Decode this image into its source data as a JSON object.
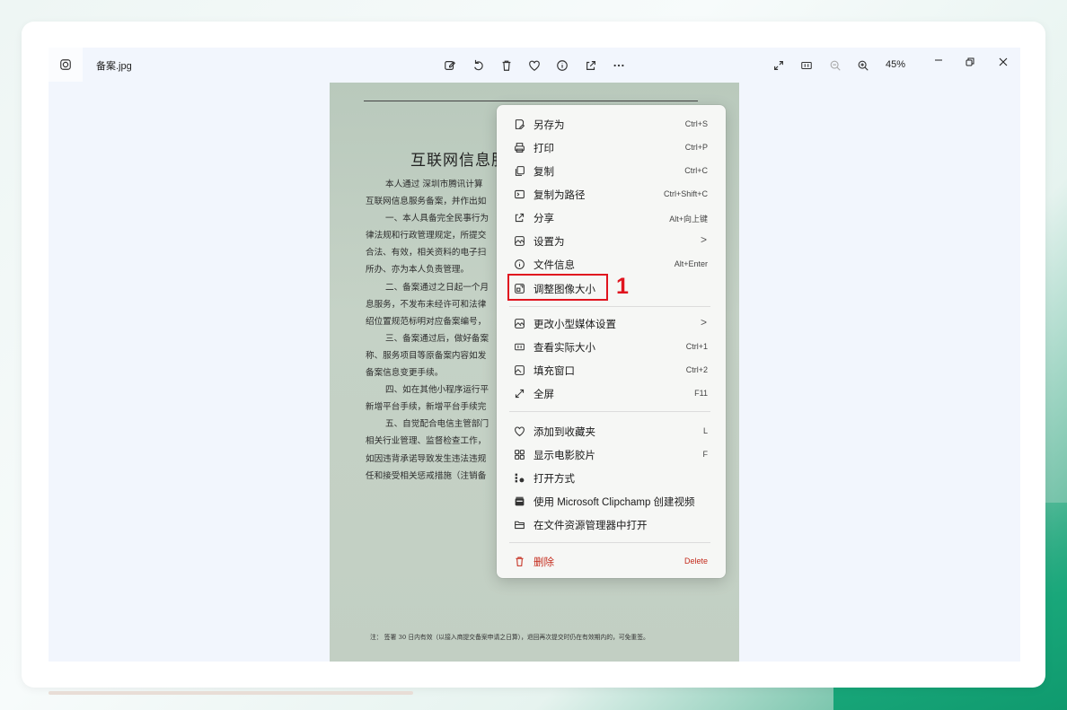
{
  "window": {
    "file_name": "备案.jpg",
    "zoom": "45%"
  },
  "document": {
    "title": "互联网信息服",
    "lines": [
      "本人通过 深圳市腾讯计算",
      "互联网信息服务备案，并作出如",
      "一、本人具备完全民事行为",
      "律法规和行政管理规定，所提交",
      "合法、有效，相关资料的电子扫",
      "所办、亦为本人负责管理。",
      "二、备案通过之日起一个月",
      "息服务，不发布未经许可和法律",
      "绍位置规范标明对应备案编号，",
      "三、备案通过后，做好备案",
      "称、服务项目等原备案内容如发",
      "备案信息变更手续。",
      "四、如在其他小程序运行平",
      "新增平台手续，新增平台手续完",
      "五、自觉配合电信主管部门",
      "相关行业管理、监督检查工作，",
      "如因违背承诺导致发生违法违规",
      "任和接受相关惩戒措施（注销备"
    ],
    "note": "注：  签署 30 日内有效（以接入商提交备案申请之日算），退回再次提交时仍在有效期内的，可免重签。"
  },
  "context_menu": {
    "items": [
      {
        "icon": "save-as-icon",
        "label": "另存为",
        "shortcut": "Ctrl+S"
      },
      {
        "icon": "print-icon",
        "label": "打印",
        "shortcut": "Ctrl+P"
      },
      {
        "icon": "copy-icon",
        "label": "复制",
        "shortcut": "Ctrl+C"
      },
      {
        "icon": "copy-path-icon",
        "label": "复制为路径",
        "shortcut": "Ctrl+Shift+C"
      },
      {
        "icon": "share-icon",
        "label": "分享",
        "shortcut": "Alt+向上键"
      },
      {
        "icon": "set-as-icon",
        "label": "设置为",
        "shortcut": ">"
      },
      {
        "icon": "info-icon",
        "label": "文件信息",
        "shortcut": "Alt+Enter"
      },
      {
        "icon": "resize-icon",
        "label": "调整图像大小",
        "shortcut": ""
      },
      {
        "icon": "media-settings-icon",
        "label": "更改小型媒体设置",
        "shortcut": ">"
      },
      {
        "icon": "actual-size-icon",
        "label": "查看实际大小",
        "shortcut": "Ctrl+1"
      },
      {
        "icon": "fill-window-icon",
        "label": "填充窗口",
        "shortcut": "Ctrl+2"
      },
      {
        "icon": "fullscreen-icon",
        "label": "全屏",
        "shortcut": "F11"
      },
      {
        "icon": "heart-icon",
        "label": "添加到收藏夹",
        "shortcut": "L"
      },
      {
        "icon": "filmstrip-icon",
        "label": "显示电影胶片",
        "shortcut": "F"
      },
      {
        "icon": "open-with-icon",
        "label": "打开方式",
        "shortcut": ""
      },
      {
        "icon": "clipchamp-icon",
        "label": "使用 Microsoft Clipchamp 创建视频",
        "shortcut": ""
      },
      {
        "icon": "folder-icon",
        "label": "在文件资源管理器中打开",
        "shortcut": ""
      },
      {
        "icon": "delete-icon",
        "label": "删除",
        "shortcut": "Delete"
      }
    ]
  },
  "annotation": {
    "step_number": "1",
    "color": "#e0141e"
  }
}
